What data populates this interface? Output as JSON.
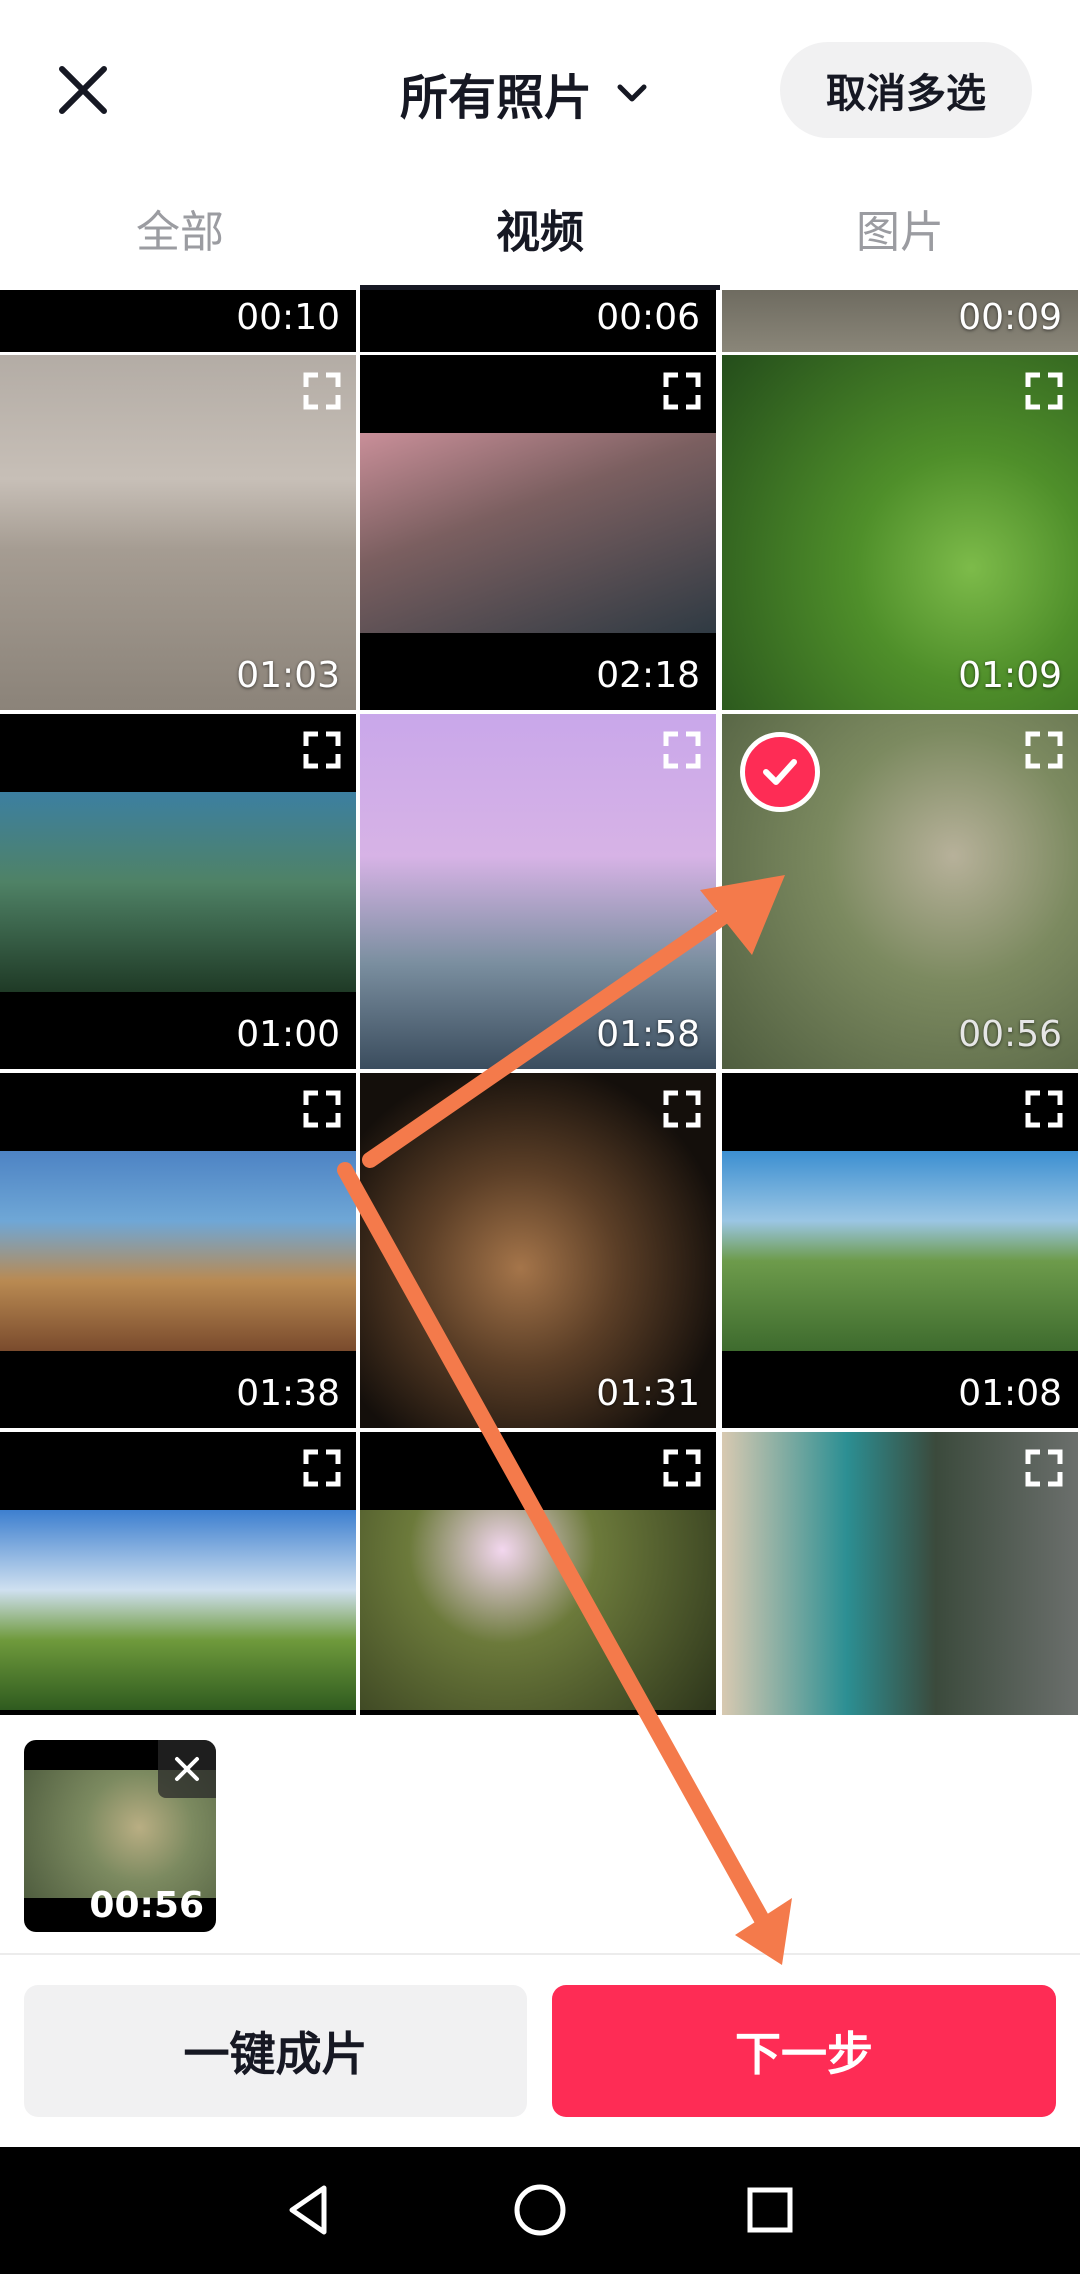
{
  "header": {
    "close_icon": "close-icon",
    "album_title": "所有照片",
    "cancel_multiselect": "取消多选"
  },
  "tabs": [
    {
      "label": "全部",
      "active": false
    },
    {
      "label": "视频",
      "active": true
    },
    {
      "label": "图片",
      "active": false
    }
  ],
  "grid": {
    "items": [
      {
        "duration": "00:10",
        "selected": false
      },
      {
        "duration": "00:06",
        "selected": false
      },
      {
        "duration": "00:09",
        "selected": false
      },
      {
        "duration": "01:03",
        "selected": false
      },
      {
        "duration": "02:18",
        "selected": false
      },
      {
        "duration": "01:09",
        "selected": false
      },
      {
        "duration": "01:00",
        "selected": false
      },
      {
        "duration": "01:58",
        "selected": false
      },
      {
        "duration": "00:56",
        "selected": true
      },
      {
        "duration": "01:38",
        "selected": false
      },
      {
        "duration": "01:31",
        "selected": false
      },
      {
        "duration": "01:08",
        "selected": false
      },
      {
        "duration": "",
        "selected": false
      },
      {
        "duration": "",
        "selected": false
      },
      {
        "duration": "",
        "selected": false
      }
    ]
  },
  "tray": {
    "selected": [
      {
        "duration": "00:56"
      }
    ]
  },
  "actions": {
    "one_click": "一键成片",
    "next": "下一步"
  },
  "colors": {
    "accent": "#fe2c55",
    "annotation_arrow": "#f47a4b"
  }
}
